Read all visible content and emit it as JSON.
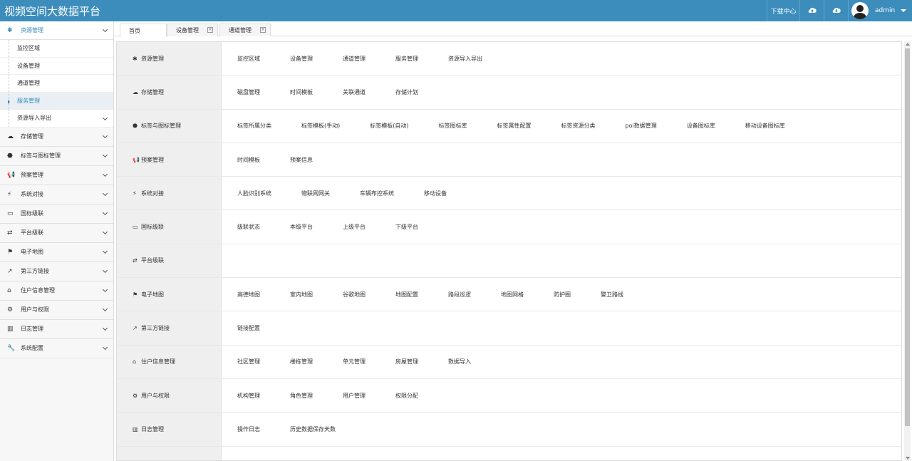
{
  "header": {
    "title": "视频空间大数据平台",
    "download_label": "下载中心",
    "username": "admin"
  },
  "sidebar": {
    "items": [
      {
        "icon": "✱",
        "label": "资源管理",
        "active": true,
        "children": [
          "监控区域",
          "设备管理",
          "通道管理",
          "服务管理",
          "资源导入导出"
        ],
        "selected_child": 3
      },
      {
        "icon": "☁",
        "label": "存储管理"
      },
      {
        "icon": "⬣",
        "label": "标签与图标管理"
      },
      {
        "icon": "📢",
        "label": "预案管理"
      },
      {
        "icon": "⚡",
        "label": "系统对接"
      },
      {
        "icon": "▭",
        "label": "国标级联"
      },
      {
        "icon": "⇄",
        "label": "平台级联"
      },
      {
        "icon": "⚑",
        "label": "电子地图"
      },
      {
        "icon": "↗",
        "label": "第三方链接"
      },
      {
        "icon": "⌂",
        "label": "住户信息管理"
      },
      {
        "icon": "⚙",
        "label": "用户与权限"
      },
      {
        "icon": "▥",
        "label": "日志管理"
      },
      {
        "icon": "🔧",
        "label": "系统配置"
      }
    ]
  },
  "tabs": [
    {
      "label": "首页",
      "closable": false,
      "active": true
    },
    {
      "label": "设备管理",
      "closable": true
    },
    {
      "label": "通道管理",
      "closable": true
    }
  ],
  "sections": [
    {
      "icon": "✱",
      "label": "资源管理",
      "links": [
        "监控区域",
        "设备管理",
        "通道管理",
        "服务管理",
        "资源导入导出"
      ]
    },
    {
      "icon": "☁",
      "label": "存储管理",
      "links": [
        "磁盘管理",
        "时间模板",
        "关联通道",
        "存储计划"
      ]
    },
    {
      "icon": "⬣",
      "label": "标签与图标管理",
      "links": [
        "标签所属分类",
        "标签模板(手动)",
        "标签模板(自动)",
        "标签图标库",
        "标签属性配置",
        "标签资源分类",
        "poi数据管理",
        "设备图标库",
        "移动设备图标库"
      ]
    },
    {
      "icon": "📢",
      "label": "预案管理",
      "links": [
        "时间模板",
        "预案信息"
      ]
    },
    {
      "icon": "⚡",
      "label": "系统对接",
      "links": [
        "人脸识别系统",
        "物联网网关",
        "车辆布控系统",
        "移动设备"
      ]
    },
    {
      "icon": "▭",
      "label": "国标级联",
      "links": [
        "级联状态",
        "本级平台",
        "上级平台",
        "下级平台"
      ]
    },
    {
      "icon": "⇄",
      "label": "平台级联",
      "links": []
    },
    {
      "icon": "⚑",
      "label": "电子地图",
      "links": [
        "高德地图",
        "室内地图",
        "谷歌地图",
        "地图配置",
        "路段巡逻",
        "地图网格",
        "防护圈",
        "警卫路线"
      ]
    },
    {
      "icon": "↗",
      "label": "第三方链接",
      "links": [
        "链接配置"
      ]
    },
    {
      "icon": "⌂",
      "label": "住户信息管理",
      "links": [
        "社区管理",
        "楼栋管理",
        "单元管理",
        "房屋管理",
        "数据导入"
      ]
    },
    {
      "icon": "⚙",
      "label": "用户与权限",
      "links": [
        "机构管理",
        "角色管理",
        "用户管理",
        "权限分配"
      ]
    },
    {
      "icon": "▥",
      "label": "日志管理",
      "links": [
        "操作日志",
        "历史数据保存天数"
      ]
    },
    {
      "icon": "",
      "label": "",
      "links": []
    }
  ]
}
